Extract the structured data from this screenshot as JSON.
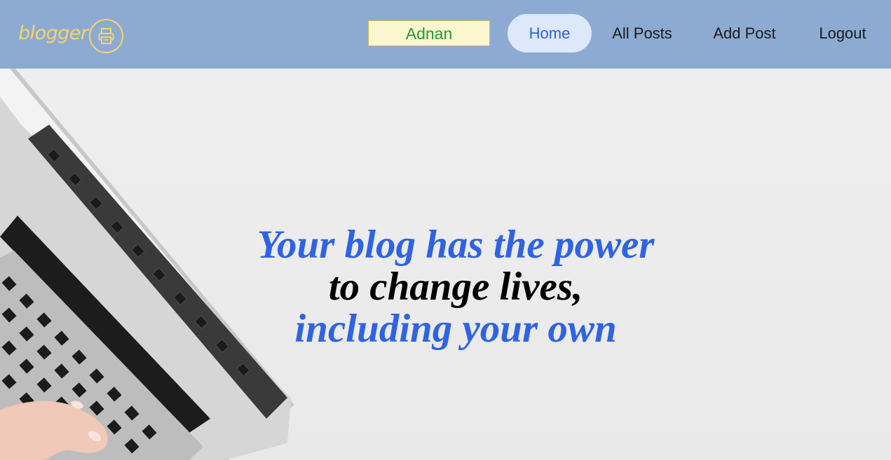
{
  "navbar": {
    "brand": "blogger",
    "brand_color": "#f5d46a",
    "background": "#8dabd2",
    "user_name": "Adnan",
    "links": [
      {
        "label": "Home",
        "active": true
      },
      {
        "label": "All Posts",
        "active": false
      },
      {
        "label": "Add Post",
        "active": false
      },
      {
        "label": "Logout",
        "active": false
      }
    ]
  },
  "hero": {
    "line1": "Your blog has the power",
    "line2": "to change lives,",
    "line3": "including your own",
    "accent_color": "#2f63e3"
  },
  "icons": {
    "logo": "printer-icon"
  }
}
